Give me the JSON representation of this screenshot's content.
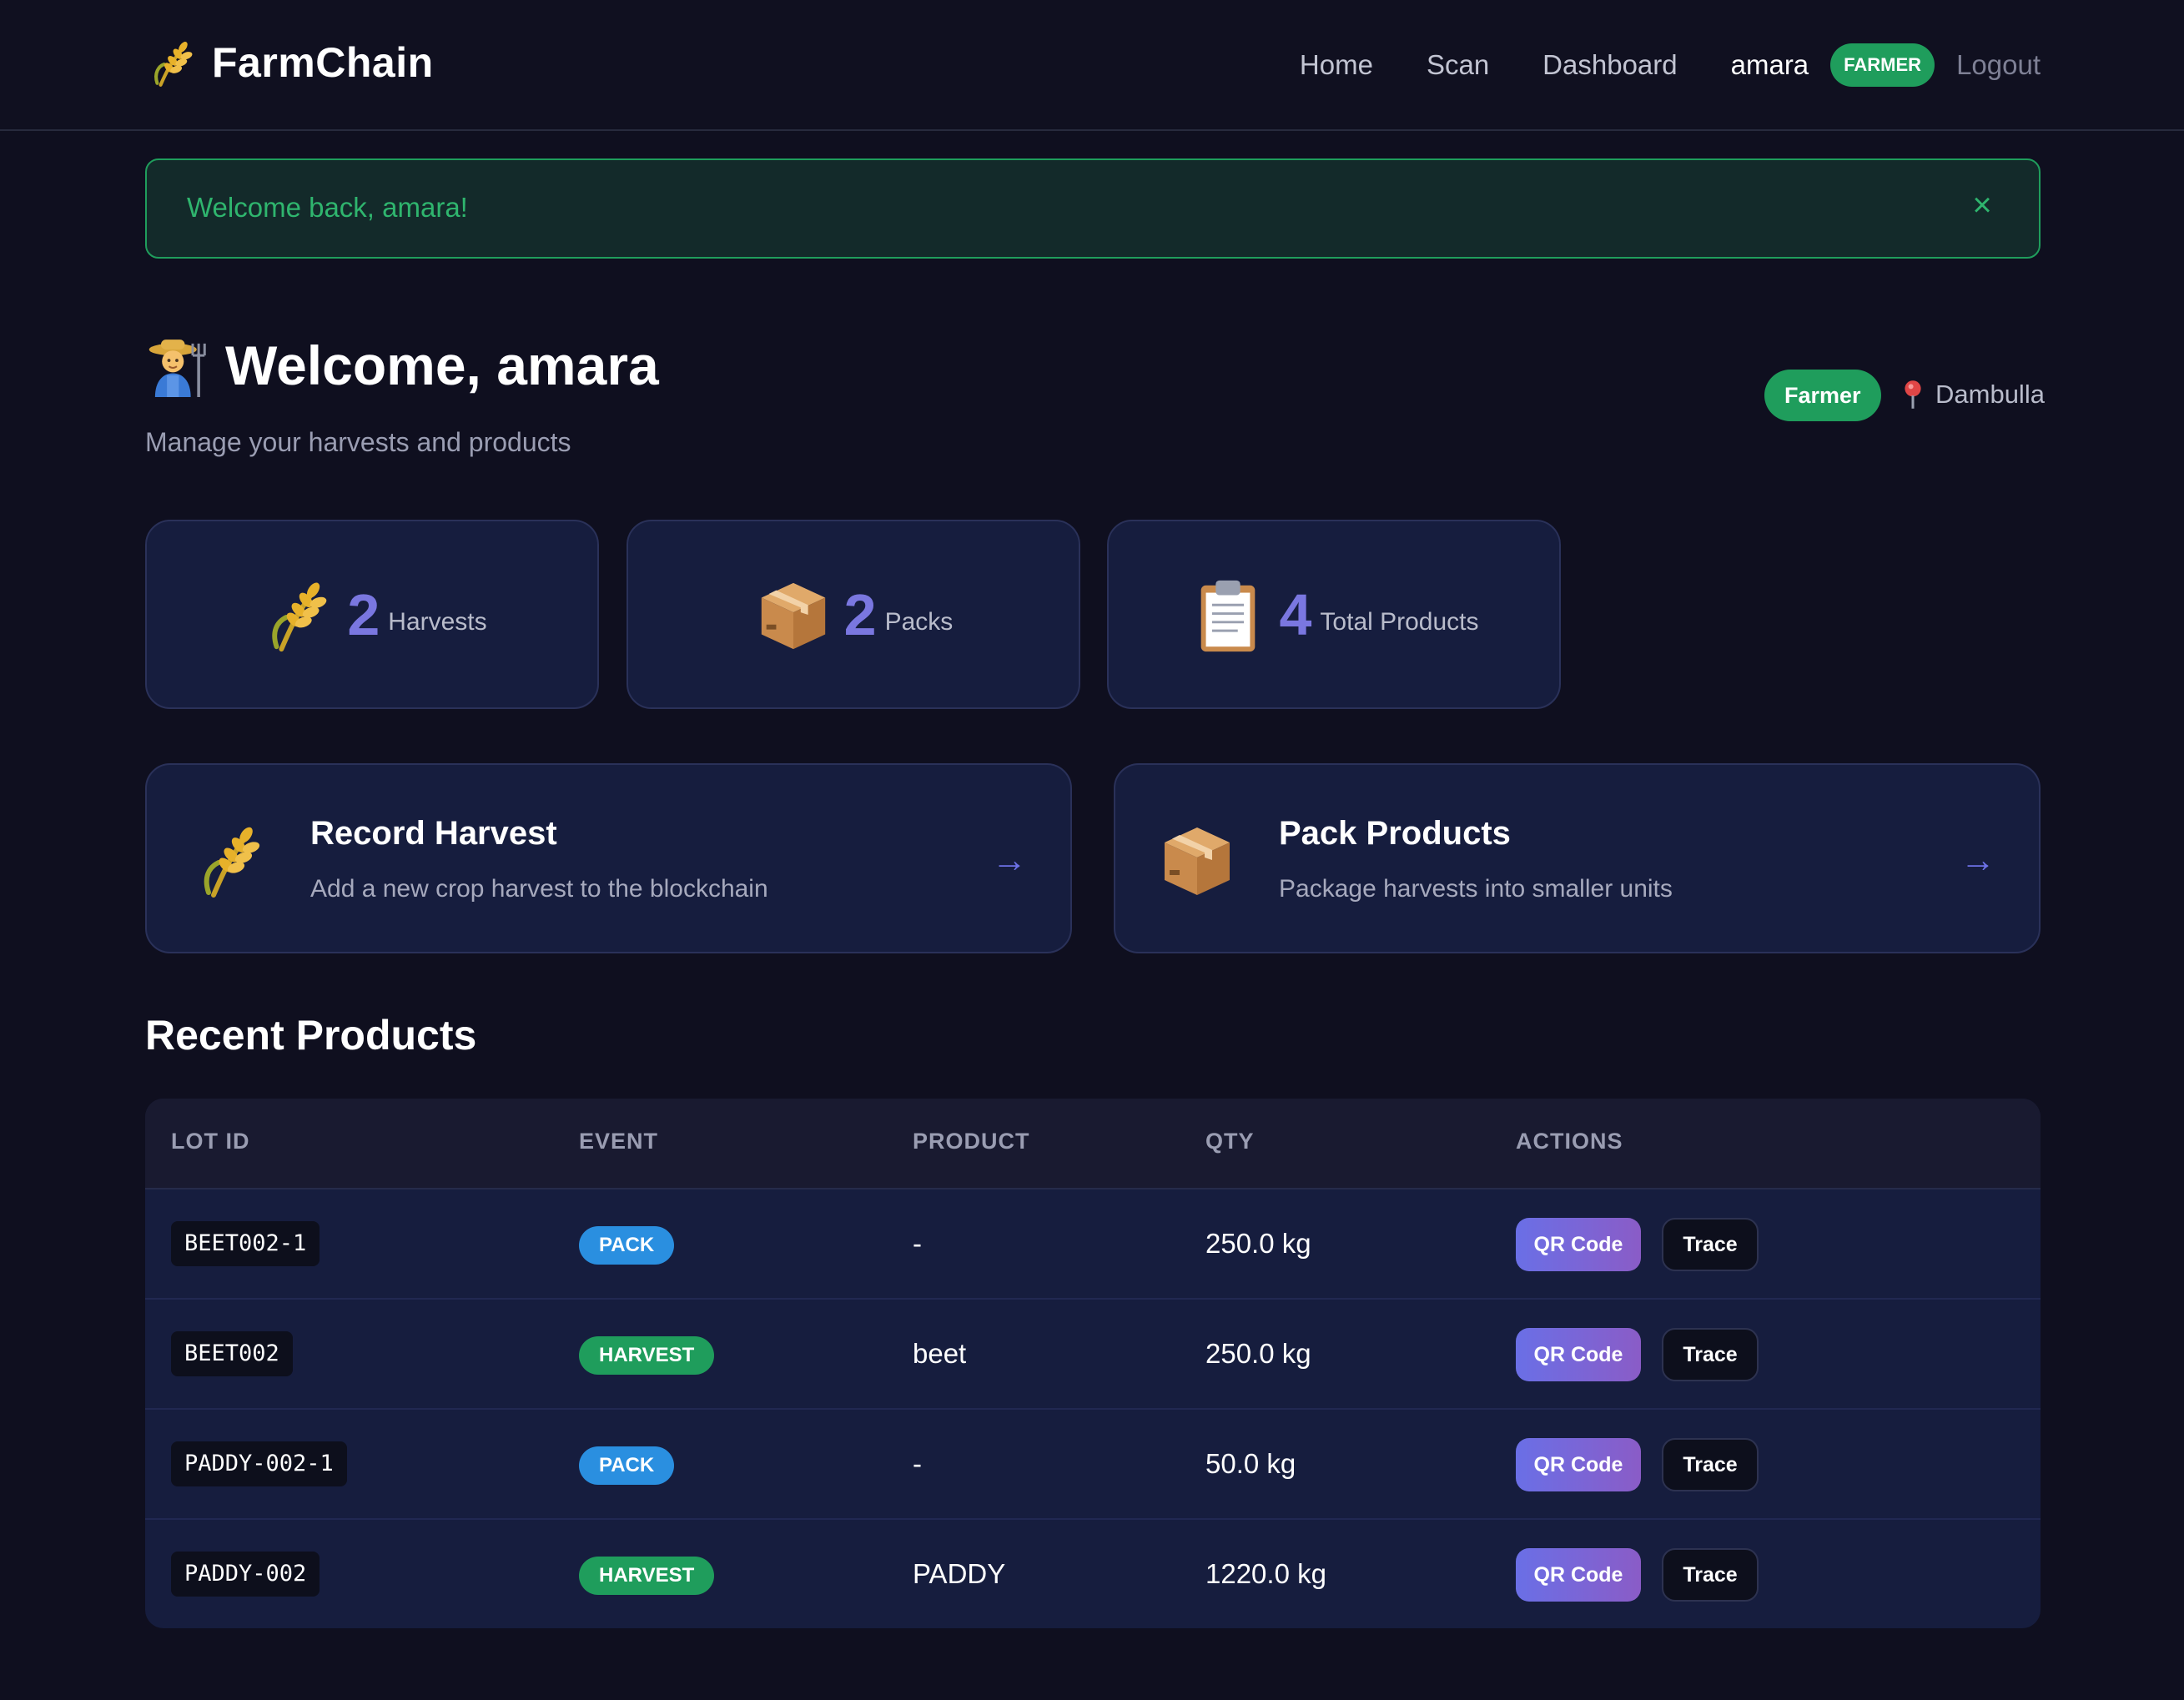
{
  "navbar": {
    "brand": "FarmChain",
    "brand_icon": "wheat-icon",
    "links": [
      "Home",
      "Scan",
      "Dashboard"
    ],
    "user": "amara",
    "role_badge": "FARMER",
    "logout": "Logout"
  },
  "alert": {
    "message": "Welcome back, amara!",
    "close": "×"
  },
  "header": {
    "title": "Welcome, amara",
    "subtitle": "Manage your harvests and products",
    "role": "Farmer",
    "location": "Dambulla"
  },
  "stats": [
    {
      "icon": "wheat-icon",
      "value": "2",
      "label": "Harvests"
    },
    {
      "icon": "package-icon",
      "value": "2",
      "label": "Packs"
    },
    {
      "icon": "clipboard-icon",
      "value": "4",
      "label": "Total Products"
    }
  ],
  "actions": [
    {
      "icon": "wheat-icon",
      "title": "Record Harvest",
      "description": "Add a new crop harvest to the blockchain",
      "arrow": "→"
    },
    {
      "icon": "package-icon",
      "title": "Pack Products",
      "description": "Package harvests into smaller units",
      "arrow": "→"
    }
  ],
  "recent": {
    "title": "Recent Products",
    "columns": [
      "LOT ID",
      "EVENT",
      "PRODUCT",
      "QTY",
      "ACTIONS"
    ],
    "qr_label": "QR Code",
    "trace_label": "Trace",
    "rows": [
      {
        "lot_id": "BEET002-1",
        "event": "PACK",
        "product": "-",
        "qty": "250.0 kg"
      },
      {
        "lot_id": "BEET002",
        "event": "HARVEST",
        "product": "beet",
        "qty": "250.0 kg"
      },
      {
        "lot_id": "PADDY-002-1",
        "event": "PACK",
        "product": "-",
        "qty": "50.0 kg"
      },
      {
        "lot_id": "PADDY-002",
        "event": "HARVEST",
        "product": "PADDY",
        "qty": "1220.0 kg"
      }
    ]
  },
  "colors": {
    "background": "#0f0f1f",
    "card": "#161d3e",
    "accent_green": "#1f9d5c",
    "accent_purple": "#7a77e0",
    "pack_blue": "#2a8fe0"
  }
}
